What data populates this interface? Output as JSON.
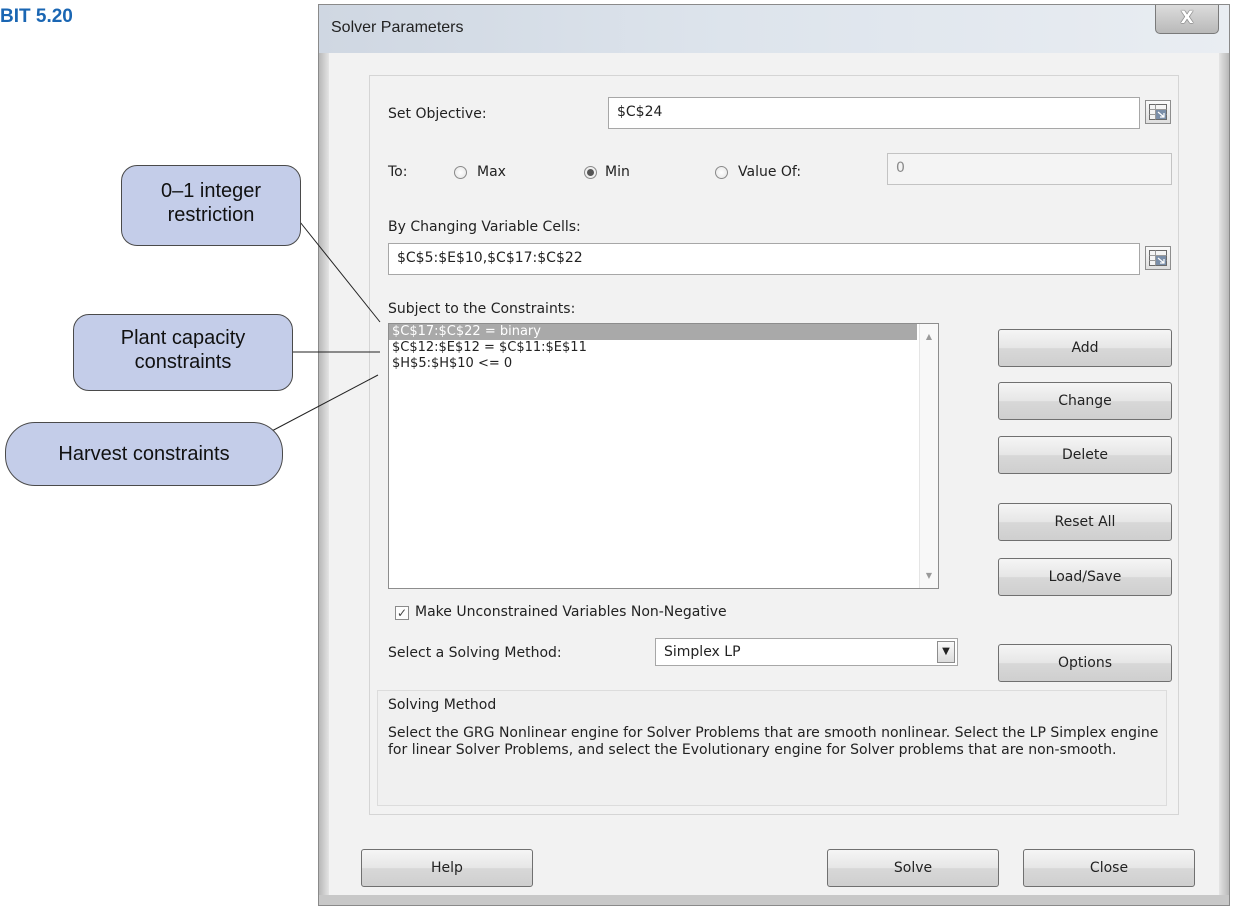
{
  "figure_label": "BIT 5.20",
  "window": {
    "title": "Solver Parameters",
    "close_glyph": "X"
  },
  "objective": {
    "label": "Set Objective:",
    "value": "$C$24"
  },
  "to": {
    "label": "To:",
    "max_label": "Max",
    "min_label": "Min",
    "value_of_label": "Value Of:",
    "value_of_value": "0",
    "selected": "Min"
  },
  "changing_cells": {
    "label": "By Changing Variable Cells:",
    "value": "$C$5:$E$10,$C$17:$C$22"
  },
  "constraints": {
    "label": "Subject to the Constraints:",
    "items": [
      "$C$17:$C$22 = binary",
      "$C$12:$E$12 = $C$11:$E$11",
      "$H$5:$H$10 <= 0"
    ],
    "selected_index": 0
  },
  "side_buttons": {
    "add": "Add",
    "change": "Change",
    "delete": "Delete",
    "reset_all": "Reset All",
    "load_save": "Load/Save",
    "options": "Options"
  },
  "nonneg": {
    "label": "Make Unconstrained Variables Non-Negative",
    "checked": true
  },
  "solving_method": {
    "label": "Select a Solving Method:",
    "value": "Simplex LP"
  },
  "method_info": {
    "title": "Solving Method",
    "description": "Select the GRG Nonlinear engine for Solver Problems that are smooth nonlinear. Select the LP Simplex engine for linear Solver Problems, and select the Evolutionary engine for Solver problems that are non-smooth."
  },
  "bottom_buttons": {
    "help": "Help",
    "solve": "Solve",
    "close": "Close"
  },
  "callouts": {
    "integer": [
      "0–1 integer",
      "restriction"
    ],
    "plant": [
      "Plant capacity",
      "constraints"
    ],
    "harvest": [
      "Harvest constraints"
    ]
  },
  "colors": {
    "figure_label": "#1a66b3",
    "callout_fill": "#c4cde9",
    "selected_row": "#a9a9a9",
    "dialog_bg": "#f2f2f2"
  }
}
